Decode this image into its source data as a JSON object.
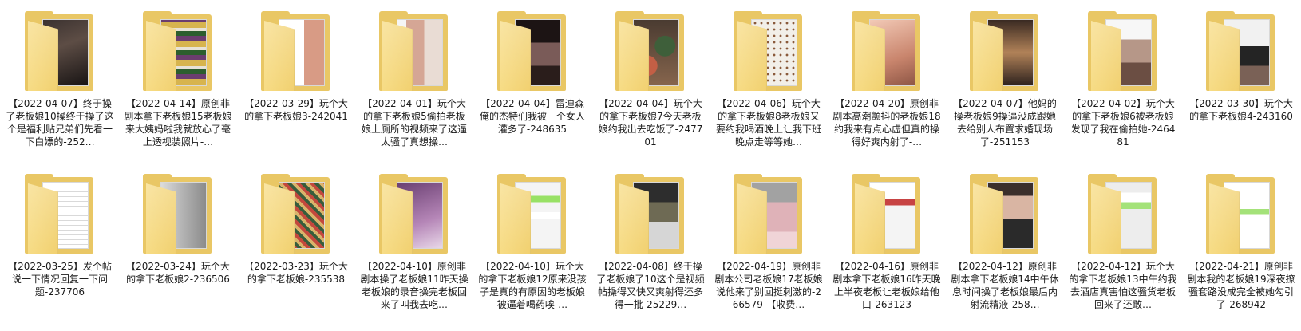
{
  "folders": [
    {
      "label": "【2022-04-07】终于操了老板娘10操终于操了这个是福利贴兄弟们先看一下白嫖的-252…",
      "thumb": "t-dark"
    },
    {
      "label": "【2022-04-14】原创非剧本拿下老板娘15老板娘来大姨妈啦我就放心了毫上透视装照片-…",
      "thumb": "t-shop"
    },
    {
      "label": "【2022-03-29】玩个大的拿下老板娘3-242041",
      "thumb": "t-paper-skin"
    },
    {
      "label": "【2022-04-01】玩个大的拿下老板娘5偷拍老板娘上厕所的视频来了这逼太骚了真想操…",
      "thumb": "t-legs"
    },
    {
      "label": "【2022-04-04】雷迪森俺的杰特们我被一个女人灌多了-248635",
      "thumb": "t-girl"
    },
    {
      "label": "【2022-04-04】玩个大的拿下老板娘7今天老板娘约我出去吃饭了-247701",
      "thumb": "t-food"
    },
    {
      "label": "【2022-04-06】玩个大的拿下老板娘8老板娘又要约我喝酒晚上让我下班晚点走等等她…",
      "thumb": "t-dotted"
    },
    {
      "label": "【2022-04-20】原创非剧本高潮颤抖的老板娘18约我来有点心虚但真的操得好爽内射了-…",
      "thumb": "t-skinwarm"
    },
    {
      "label": "【2022-04-07】他妈的操老板娘9操逼没成跟她去给别人布置求婚现场了-251153",
      "thumb": "t-party"
    },
    {
      "label": "【2022-04-02】玩个大的拿下老板娘6被老板娘发现了我在偷拍她-246481",
      "thumb": "t-bed"
    },
    {
      "label": "【2022-03-30】玩个大的拿下老板娘4-243160",
      "thumb": "t-room"
    },
    {
      "label": "【2022-03-25】发个帖说一下情况回复一下问题-237706",
      "thumb": "t-paper"
    },
    {
      "label": "【2022-03-24】玩个大的拿下老板娘2-236506",
      "thumb": "t-bath"
    },
    {
      "label": "【2022-03-23】玩个大的拿下老板娘-235538",
      "thumb": "t-mosaic"
    },
    {
      "label": "【2022-04-10】原创非剧本操了老板娘11昨天操老板娘的录音操完老板回来了叫我去吃…",
      "thumb": "t-purple"
    },
    {
      "label": "【2022-04-10】玩个大的拿下老板娘12原来没孩子是真的有原因的老板娘被逼着喝药唉-…",
      "thumb": "t-chat"
    },
    {
      "label": "【2022-04-08】终于操了老板娘了10这个是视频帖操得又快又爽射得还多得一批-25229…",
      "thumb": "t-phone"
    },
    {
      "label": "【2022-04-19】原创非剧本公司老板娘17老板娘说他来了别回挺刺激的-266579-【收费…",
      "thumb": "t-pink"
    },
    {
      "label": "【2022-04-16】原创非剧本拿下老板娘16昨天晚上半夜老板让老板娘给他口-263123",
      "thumb": "t-redchat"
    },
    {
      "label": "【2022-04-12】原创非剧本拿下老板娘14中午休息时间操了老板娘最后内射流精液-258…",
      "thumb": "t-face"
    },
    {
      "label": "【2022-04-12】玩个大的拿下老板娘13中午约我去酒店真害怕这骚货老板回来了还敢…",
      "thumb": "t-chat2"
    },
    {
      "label": "【2022-04-21】原创非剧本我的老板娘19深夜撩骚套路没成完全被她勾引了-268942",
      "thumb": "t-sketch"
    }
  ],
  "icons": {
    "folder": "folder-icon"
  }
}
